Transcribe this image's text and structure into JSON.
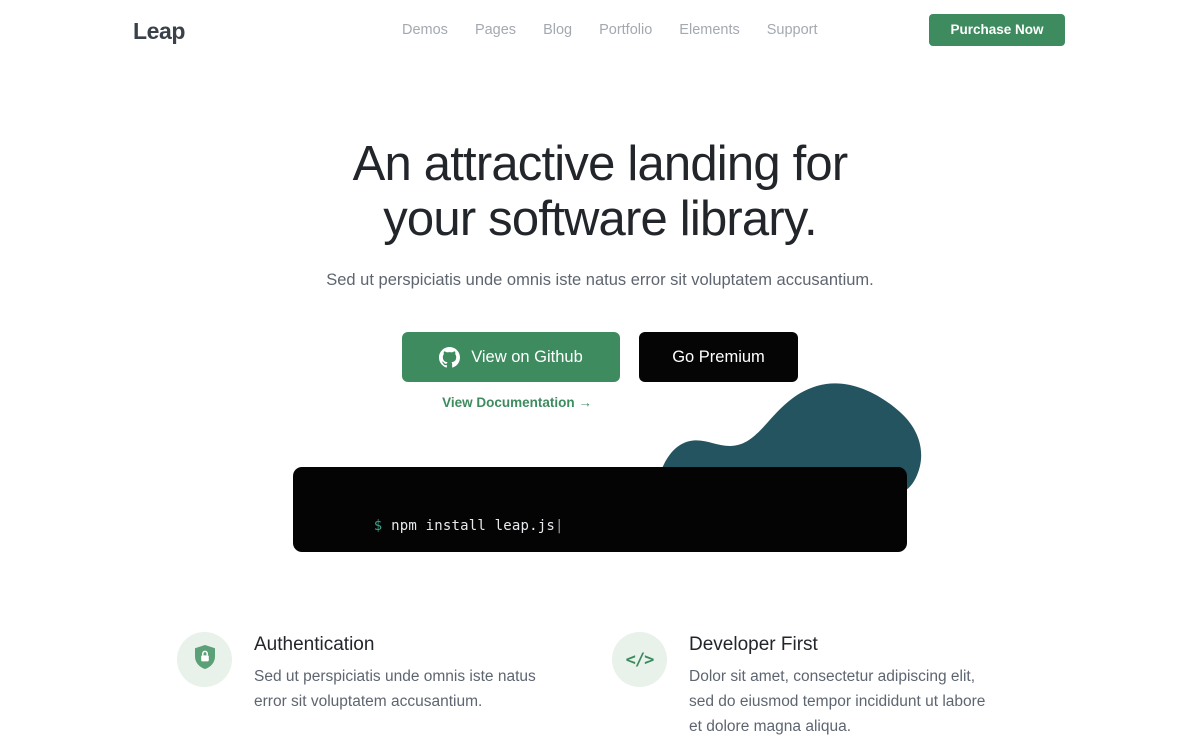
{
  "header": {
    "logo": "Leap",
    "nav": [
      {
        "label": "Demos"
      },
      {
        "label": "Pages"
      },
      {
        "label": "Blog"
      },
      {
        "label": "Portfolio"
      },
      {
        "label": "Elements"
      },
      {
        "label": "Support"
      }
    ],
    "purchase_label": "Purchase Now"
  },
  "hero": {
    "headline_line1": "An attractive landing for",
    "headline_line2": "your software library.",
    "subtitle": "Sed ut perspiciatis unde omnis iste natus error sit voluptatem accusantium.",
    "github_button": "View on Github",
    "premium_button": "Go Premium",
    "doc_link": "View Documentation →"
  },
  "terminal": {
    "prompt": "$",
    "command": "npm install leap.js",
    "cursor": "|"
  },
  "features": [
    {
      "icon": "shield-lock-icon",
      "title": "Authentication",
      "description": "Sed ut perspiciatis unde omnis iste natus error sit voluptatem accusantium."
    },
    {
      "icon": "code-brackets-icon",
      "title": "Developer First",
      "description": "Dolor sit amet, consectetur adipiscing elit, sed do eiusmod tempor incididunt ut labore et dolore magna aliqua."
    }
  ],
  "colors": {
    "brand_green": "#3d8b5f",
    "blob_teal": "#245460",
    "terminal_black": "#040404",
    "icon_circle": "#e8f1ea",
    "heading": "#22262b",
    "body_text": "#5e6570",
    "nav_text": "#a4a9b0"
  }
}
